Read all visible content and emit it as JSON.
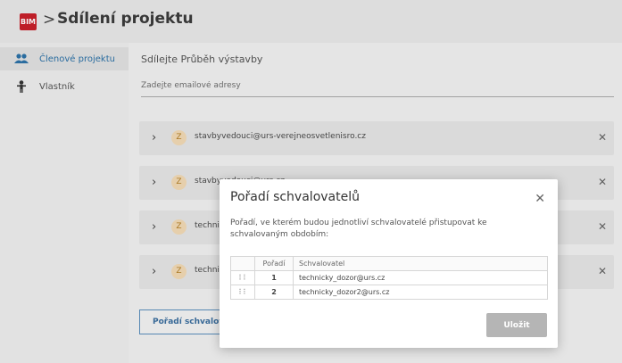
{
  "header": {
    "logo_text": "BIM",
    "breadcrumb_separator": ">",
    "title": "Sdílení projektu"
  },
  "sidebar": {
    "items": [
      {
        "label": "Členové projektu",
        "icon": "people-icon",
        "active": true
      },
      {
        "label": "Vlastník",
        "icon": "owner-icon",
        "active": false
      }
    ]
  },
  "main": {
    "share_label": "Sdílejte  Průběh výstavby",
    "email_placeholder": "Zadejte emailové adresy",
    "members": [
      {
        "avatar": "Z",
        "email": "stavbyvedouci@urs-verejneosvetlenisro.cz"
      },
      {
        "avatar": "Z",
        "email": "stavbyvedouci@urs.cz"
      },
      {
        "avatar": "Z",
        "email": "technicky_dozor@urs.cz"
      },
      {
        "avatar": "Z",
        "email": "technicky_dozor2@urs.cz"
      }
    ],
    "order_button": "Pořadí schvalovatelů"
  },
  "modal": {
    "title": "Pořadí schvalovatelů",
    "description": "Pořadí, ve kterém budou jednotliví schvalovatelé přistupovat ke schvalovaným obdobím:",
    "columns": [
      "",
      "Pořadí",
      "Schvalovatel"
    ],
    "rows": [
      {
        "order": "1",
        "approver": "technicky_dozor@urs.cz"
      },
      {
        "order": "2",
        "approver": "technicky_dozor2@urs.cz"
      }
    ],
    "save_label": "Uložit"
  },
  "colors": {
    "brand": "#c9202b",
    "accent": "#2d72a8",
    "avatar_bg": "#f3dbb6"
  }
}
